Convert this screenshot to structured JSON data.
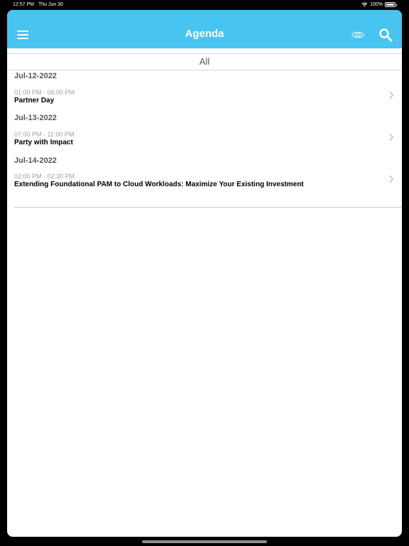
{
  "status_bar": {
    "time": "12:57 PM",
    "date": "Thu Jun 30",
    "battery": "100%"
  },
  "nav": {
    "title": "Agenda",
    "menu_icon": "hamburger-menu-icon",
    "eye_icon": "eye-icon",
    "search_icon": "search-icon",
    "accent_color": "#48c4f0"
  },
  "filter": {
    "label": "All"
  },
  "agenda": [
    {
      "date": "Jul-12-2022",
      "time": "01:00 PM - 06:00 PM",
      "title": "Partner Day"
    },
    {
      "date": "Jul-13-2022",
      "time": "07:00 PM - 11:00 PM",
      "title": "Party with Impact"
    },
    {
      "date": "Jul-14-2022",
      "time": "02:00 PM - 02:30 PM",
      "title": "Extending Foundational PAM to Cloud Workloads: Maximize Your Existing Investment"
    }
  ]
}
